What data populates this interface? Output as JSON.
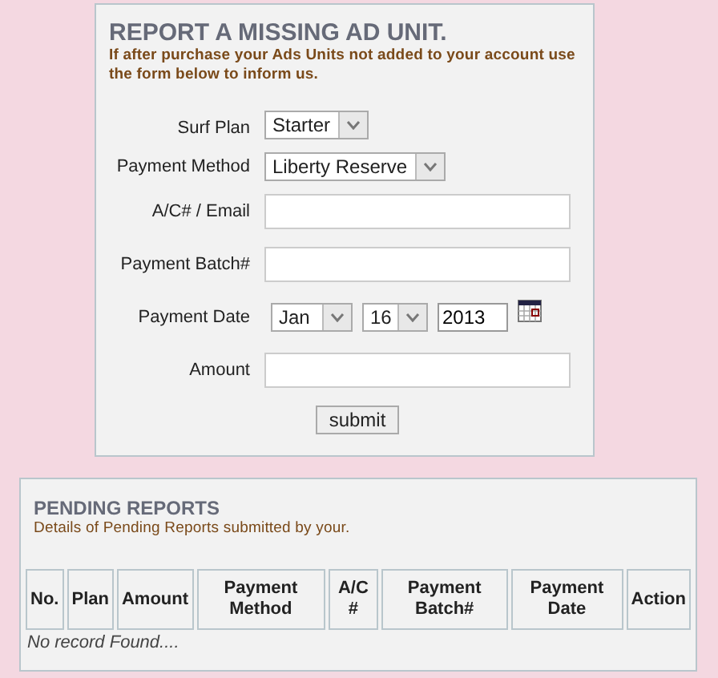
{
  "report_form": {
    "title": "REPORT A MISSING AD UNIT.",
    "description": "If after purchase your Ads Units not added to your account use the form below to inform us.",
    "fields": [
      {
        "kind": "select",
        "label": "Surf Plan",
        "value": "Starter"
      },
      {
        "kind": "select",
        "label": "Payment Method",
        "value": "Liberty Reserve"
      },
      {
        "kind": "text",
        "label": "A/C# / Email"
      },
      {
        "kind": "text",
        "label": "Payment Batch#"
      },
      {
        "kind": "date",
        "label": "Payment Date",
        "month": "Jan",
        "day": "16",
        "year": "2013"
      },
      {
        "kind": "text",
        "label": "Amount"
      }
    ],
    "submit": "submit"
  },
  "pending_reports": {
    "title": "PENDING REPORTS",
    "description": "Details of Pending Reports submitted by your.",
    "columns": [
      "No.",
      "Plan",
      "Amount",
      "Payment Method",
      "A/C #",
      "Payment Batch#",
      "Payment Date",
      "Action"
    ],
    "empty_message": "No record Found...."
  }
}
